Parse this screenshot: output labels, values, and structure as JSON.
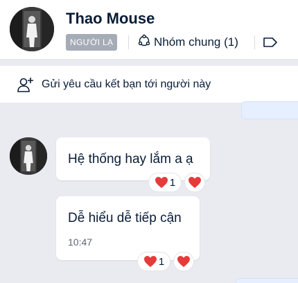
{
  "header": {
    "name": "Thao Mouse",
    "badge": "NGƯỜI LẠ",
    "group_label": "Nhóm chung (1)"
  },
  "friend_request": {
    "label": "Gửi yêu cầu kết bạn tới người này"
  },
  "messages": [
    {
      "text": "Hệ thống hay lắm a ạ",
      "reaction_count": "1"
    },
    {
      "text": "Dễ hiểu dễ tiếp cận",
      "time": "10:47",
      "reaction_count": "1"
    }
  ],
  "colors": {
    "background": "#e9ebf0",
    "badge": "#a6acb6",
    "heart": "#e53b3b",
    "text": "#081c36"
  }
}
